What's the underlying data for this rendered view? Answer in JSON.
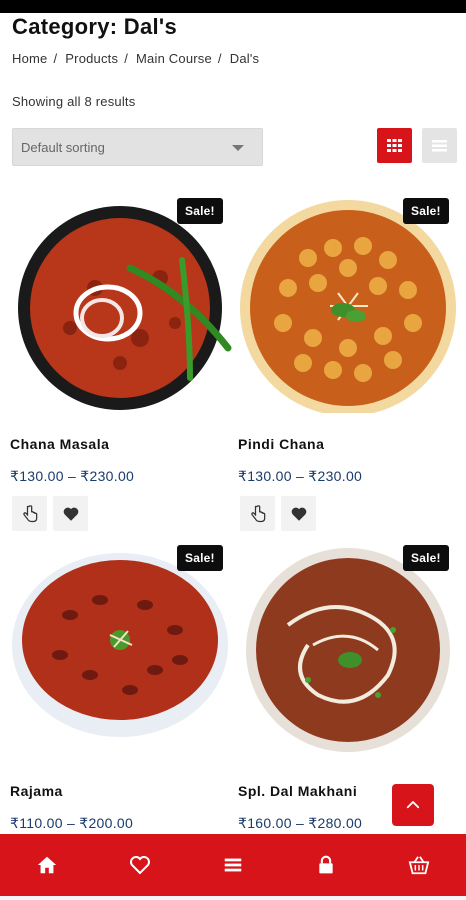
{
  "page": {
    "title": "Category: Dal's"
  },
  "breadcrumb": {
    "items": [
      "Home",
      "Products",
      "Main Course",
      "Dal's"
    ],
    "separator": "/"
  },
  "results": {
    "count_text": "Showing all 8 results"
  },
  "sorting": {
    "selected": "Default sorting"
  },
  "view_toggle": {
    "active": "grid",
    "grid_icon": "grid-icon",
    "list_icon": "list-icon"
  },
  "products": [
    {
      "name": "Chana Masala",
      "price": "₹130.00 – ₹230.00",
      "badge": "Sale!",
      "image_icon": "chana-masala-dish"
    },
    {
      "name": "Pindi Chana",
      "price": "₹130.00 – ₹230.00",
      "badge": "Sale!",
      "image_icon": "pindi-chana-dish"
    },
    {
      "name": "Rajama",
      "price": "₹110.00 – ₹200.00",
      "badge": "Sale!",
      "image_icon": "rajma-dish"
    },
    {
      "name": "Spl. Dal Makhani",
      "price": "₹160.00 – ₹280.00",
      "badge": "Sale!",
      "image_icon": "dal-makhani-dish"
    }
  ],
  "card_actions": {
    "select_icon": "hand-pointer-icon",
    "wishlist_icon": "heart-icon"
  },
  "bottom_nav": {
    "items": [
      "home-icon",
      "heart-icon",
      "menu-icon",
      "lock-icon",
      "basket-icon"
    ]
  },
  "colors": {
    "accent": "#d7141a",
    "price": "#1a3b6b",
    "badge": "#0d0d0d"
  }
}
